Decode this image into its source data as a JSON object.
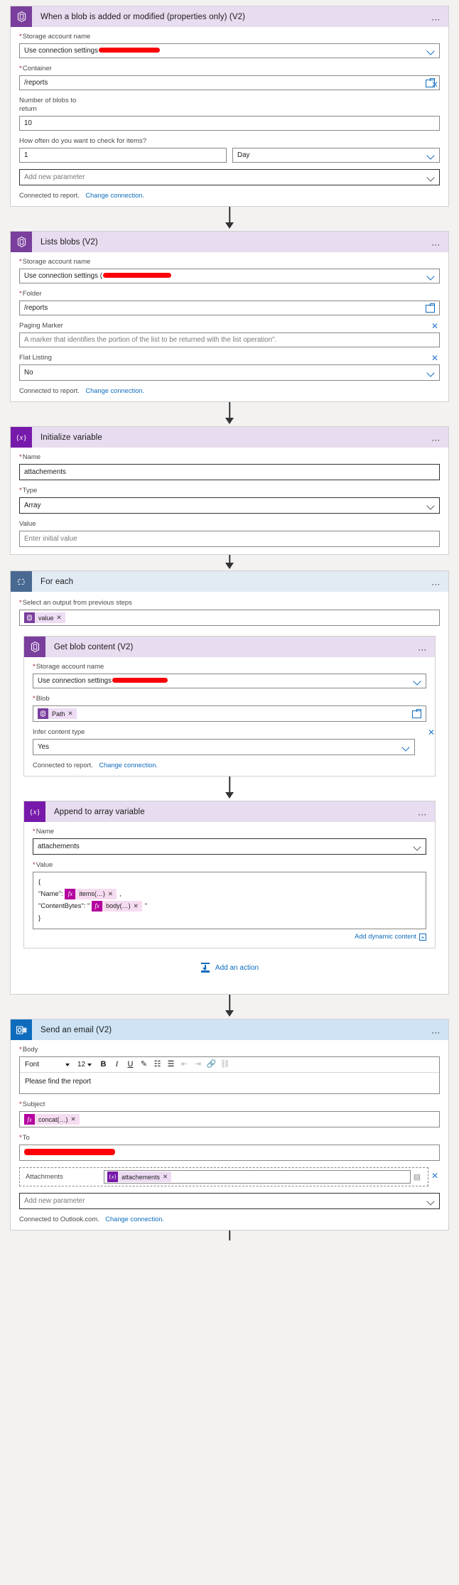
{
  "app": {
    "surface": "power-automate-flow-designer"
  },
  "steps": [
    {
      "id": "trigger-blob",
      "title": "When a blob is added or modified (properties only) (V2)",
      "icon": "azure-blob-storage-icon",
      "theme": "purple",
      "overflow": "…",
      "connection_note": "Connected to report.",
      "connection_link": "Change connection.",
      "fields": {
        "storage_account_label": "Storage account name",
        "storage_account_value": "Use connection settings",
        "container_label": "Container",
        "container_value": "/reports",
        "blobs_count_label": "Number of blobs to\nreturn",
        "blobs_count_value": "10",
        "frequency_label": "How often do you want to check for items?",
        "interval_value": "1",
        "frequency_value": "Day",
        "add_parameter": "Add new parameter"
      }
    },
    {
      "id": "lists-blobs",
      "title": "Lists blobs (V2)",
      "icon": "azure-blob-storage-icon",
      "theme": "purple",
      "overflow": "…",
      "connection_note": "Connected to report.",
      "connection_link": "Change connection.",
      "fields": {
        "storage_account_label": "Storage account name",
        "storage_account_value": "Use connection settings (",
        "folder_label": "Folder",
        "folder_value": "/reports",
        "paging_marker_label": "Paging Marker",
        "paging_marker_placeholder": "A marker that identifies the portion of the list to be returned with the list operation\".",
        "flat_listing_label": "Flat Listing",
        "flat_listing_value": "No"
      }
    },
    {
      "id": "initialize-variable",
      "title": "Initialize variable",
      "icon": "variable-icon",
      "theme": "purple",
      "overflow": "…",
      "fields": {
        "name_label": "Name",
        "name_value": "attachements",
        "type_label": "Type",
        "type_value": "Array",
        "value_label": "Value",
        "value_placeholder": "Enter initial value"
      }
    },
    {
      "id": "for-each",
      "title": "For each",
      "icon": "foreach-loop-icon",
      "theme": "blue",
      "overflow": "…",
      "fields": {
        "select_output_label": "Select an output from previous steps",
        "select_output_token": "value"
      },
      "add_action_label": "Add an action",
      "children": [
        {
          "id": "get-blob-content",
          "title": "Get blob content (V2)",
          "icon": "azure-blob-storage-icon",
          "theme": "purple",
          "overflow": "…",
          "connection_note": "Connected to report.",
          "connection_link": "Change connection.",
          "fields": {
            "storage_account_label": "Storage account name",
            "storage_account_value": "Use connection settings",
            "blob_label": "Blob",
            "blob_token": "Path",
            "infer_label": "Infer content type",
            "infer_value": "Yes"
          }
        },
        {
          "id": "append-to-array",
          "title": "Append to array variable",
          "icon": "variable-icon",
          "theme": "purple",
          "overflow": "…",
          "fields": {
            "name_label": "Name",
            "name_value": "attachements",
            "value_label": "Value",
            "value_lines": [
              {
                "text": "{",
                "token": null,
                "suffix": ""
              },
              {
                "text": "\"Name\":",
                "token": "items(…)",
                "suffix": ","
              },
              {
                "text": "\"ContentBytes\": \"",
                "token": "body(…)",
                "suffix": "\""
              },
              {
                "text": "}",
                "token": null,
                "suffix": ""
              }
            ],
            "add_dynamic_content": "Add dynamic content"
          }
        }
      ]
    },
    {
      "id": "send-email",
      "title": "Send an email (V2)",
      "icon": "outlook-icon",
      "theme": "lightblue",
      "overflow": "…",
      "connection_note": "Connected to Outlook.com.",
      "connection_link": "Change connection.",
      "fields": {
        "body_label": "Body",
        "body_text": "Please find the report",
        "subject_label": "Subject",
        "subject_token": "concat(…)",
        "to_label": "To",
        "attachments_label": "Attachments",
        "attachments_token": "attachements",
        "add_parameter": "Add new parameter"
      },
      "toolbar": {
        "font_name": "Font",
        "font_size": "12",
        "buttons": [
          {
            "name": "bold-button",
            "glyph": "B"
          },
          {
            "name": "italic-button",
            "glyph": "I"
          },
          {
            "name": "underline-button",
            "glyph": "U"
          },
          {
            "name": "font-color-button",
            "glyph": "✎"
          },
          {
            "name": "numbered-list-button",
            "glyph": "☷"
          },
          {
            "name": "bulleted-list-button",
            "glyph": "☰"
          },
          {
            "name": "decrease-indent-button",
            "glyph": "⇤"
          },
          {
            "name": "increase-indent-button",
            "glyph": "⇥"
          },
          {
            "name": "insert-link-button",
            "glyph": "🔗"
          },
          {
            "name": "remove-link-button",
            "glyph": "⛓"
          }
        ]
      }
    }
  ],
  "colors": {
    "blob_purple": "#7a3e9d",
    "variable_purple": "#7719aa",
    "foreach_blue": "#486991",
    "outlook_blue": "#0f6cbd",
    "link_blue": "#0f6cbd",
    "required_red": "#a4262c",
    "redaction_red": "#fb0007",
    "canvas_bg": "#f3f2f1"
  }
}
